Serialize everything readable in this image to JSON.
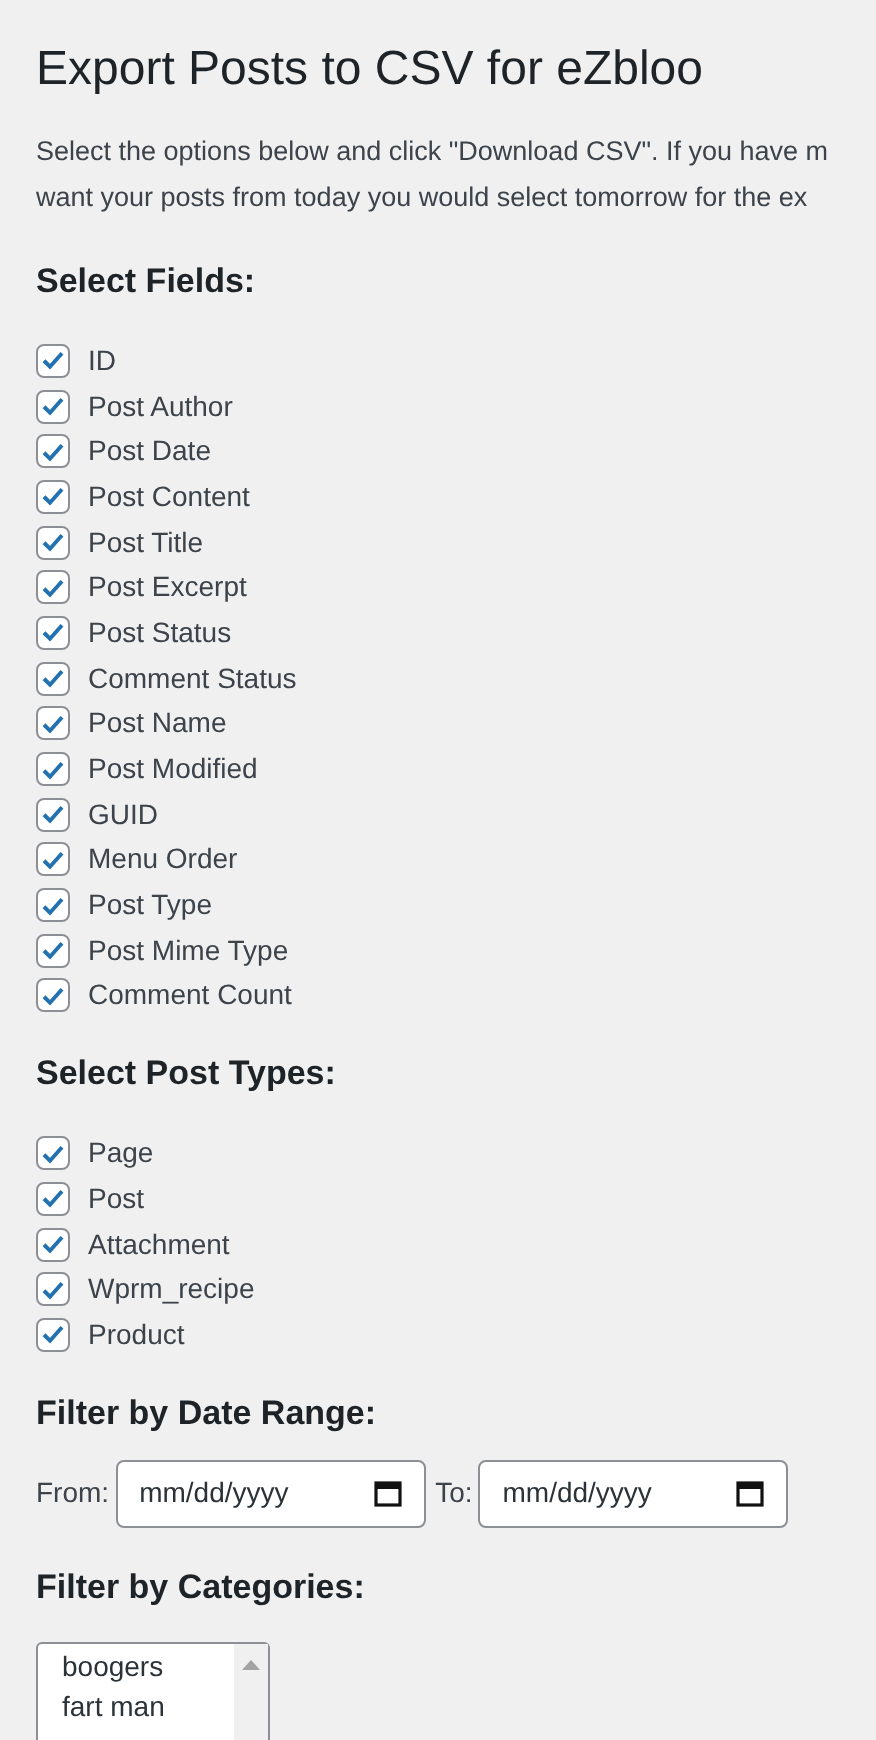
{
  "title": "Export Posts to CSV for eZbloo",
  "description_lines": [
    "Select the options below and click \"Download CSV\". If you have m",
    "want your posts from today you would select tomorrow for the ex"
  ],
  "fields_heading": "Select Fields:",
  "fields": [
    {
      "label": "ID",
      "checked": true
    },
    {
      "label": "Post Author",
      "checked": true
    },
    {
      "label": "Post Date",
      "checked": true
    },
    {
      "label": "Post Content",
      "checked": true
    },
    {
      "label": "Post Title",
      "checked": true
    },
    {
      "label": "Post Excerpt",
      "checked": true
    },
    {
      "label": "Post Status",
      "checked": true
    },
    {
      "label": "Comment Status",
      "checked": true
    },
    {
      "label": "Post Name",
      "checked": true
    },
    {
      "label": "Post Modified",
      "checked": true
    },
    {
      "label": "GUID",
      "checked": true
    },
    {
      "label": "Menu Order",
      "checked": true
    },
    {
      "label": "Post Type",
      "checked": true
    },
    {
      "label": "Post Mime Type",
      "checked": true
    },
    {
      "label": "Comment Count",
      "checked": true
    }
  ],
  "post_types_heading": "Select Post Types:",
  "post_types": [
    {
      "label": "Page",
      "checked": true
    },
    {
      "label": "Post",
      "checked": true
    },
    {
      "label": "Attachment",
      "checked": true
    },
    {
      "label": "Wprm_recipe",
      "checked": true
    },
    {
      "label": "Product",
      "checked": true
    }
  ],
  "date_heading": "Filter by Date Range:",
  "date_from": {
    "label": "From:",
    "placeholder": "mm/dd/yyyy"
  },
  "date_to": {
    "label": "To:",
    "placeholder": "mm/dd/yyyy"
  },
  "categories_heading": "Filter by Categories:",
  "categories": [
    "boogers",
    "fart man"
  ]
}
